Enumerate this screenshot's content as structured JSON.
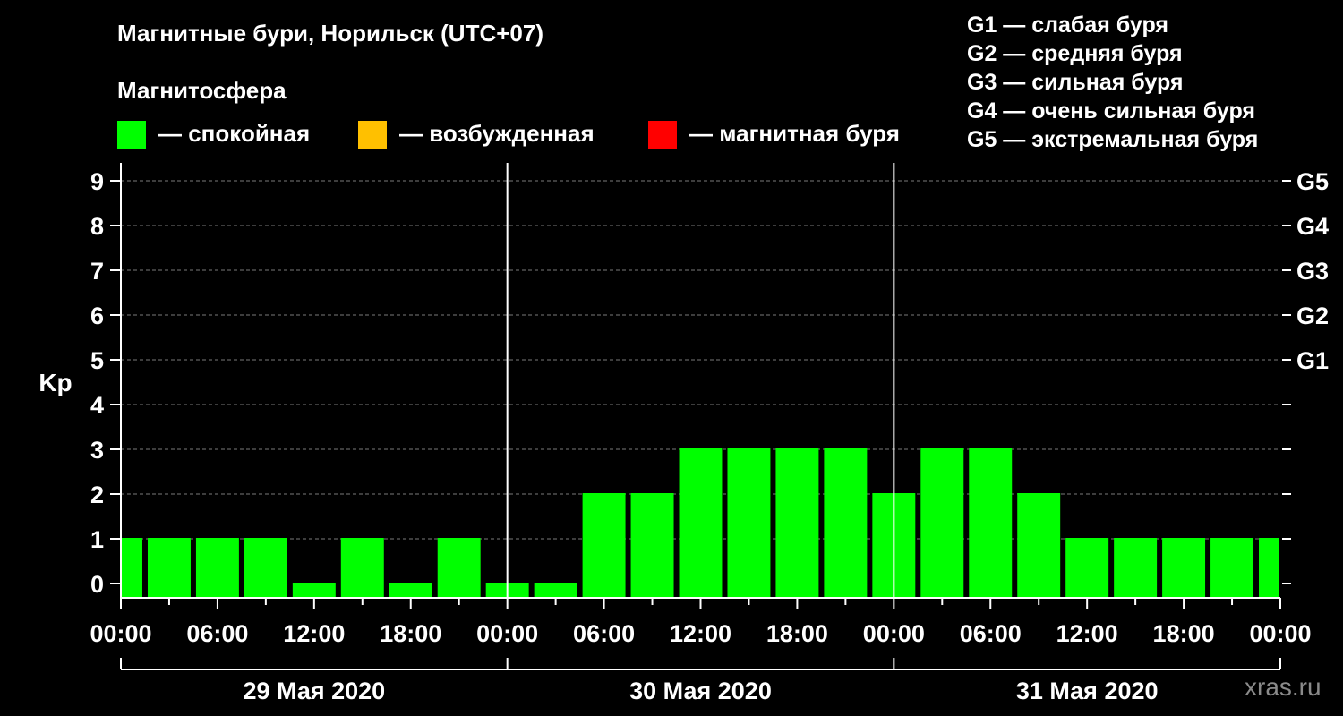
{
  "title": "Магнитные бури, Норильск (UTC+07)",
  "subtitle": "Магнитосфера",
  "legend": [
    {
      "label": "— спокойная",
      "color": "#00ff00"
    },
    {
      "label": "— возбужденная",
      "color": "#ffc000"
    },
    {
      "label": "— магнитная буря",
      "color": "#ff0000"
    }
  ],
  "g_legend": [
    "G1 — слабая буря",
    "G2 — средняя буря",
    "G3 — сильная буря",
    "G4 — очень сильная буря",
    "G5 — экстремальная буря"
  ],
  "watermark": "xras.ru",
  "chart_data": {
    "type": "bar",
    "ylabel": "Kp",
    "ylim": [
      0,
      9
    ],
    "yticks": [
      0,
      1,
      2,
      3,
      4,
      5,
      6,
      7,
      8,
      9
    ],
    "g_levels": [
      {
        "label": "G1",
        "kp": 5
      },
      {
        "label": "G2",
        "kp": 6
      },
      {
        "label": "G3",
        "kp": 7
      },
      {
        "label": "G4",
        "kp": 8
      },
      {
        "label": "G5",
        "kp": 9
      }
    ],
    "grid": true,
    "x_tick_labels": [
      "00:00",
      "06:00",
      "12:00",
      "18:00",
      "00:00",
      "06:00",
      "12:00",
      "18:00",
      "00:00",
      "06:00",
      "12:00",
      "18:00",
      "00:00"
    ],
    "days": [
      "29 Мая 2020",
      "30 Мая 2020",
      "31 Мая 2020"
    ],
    "interval_hours": 3,
    "series": [
      {
        "values": [
          1,
          1,
          1,
          1,
          0,
          1,
          0,
          1,
          0,
          0,
          2,
          2,
          3,
          3,
          3,
          3,
          2,
          3,
          3,
          2,
          1,
          1,
          1,
          1,
          1
        ],
        "color": "#00ff00"
      }
    ]
  }
}
